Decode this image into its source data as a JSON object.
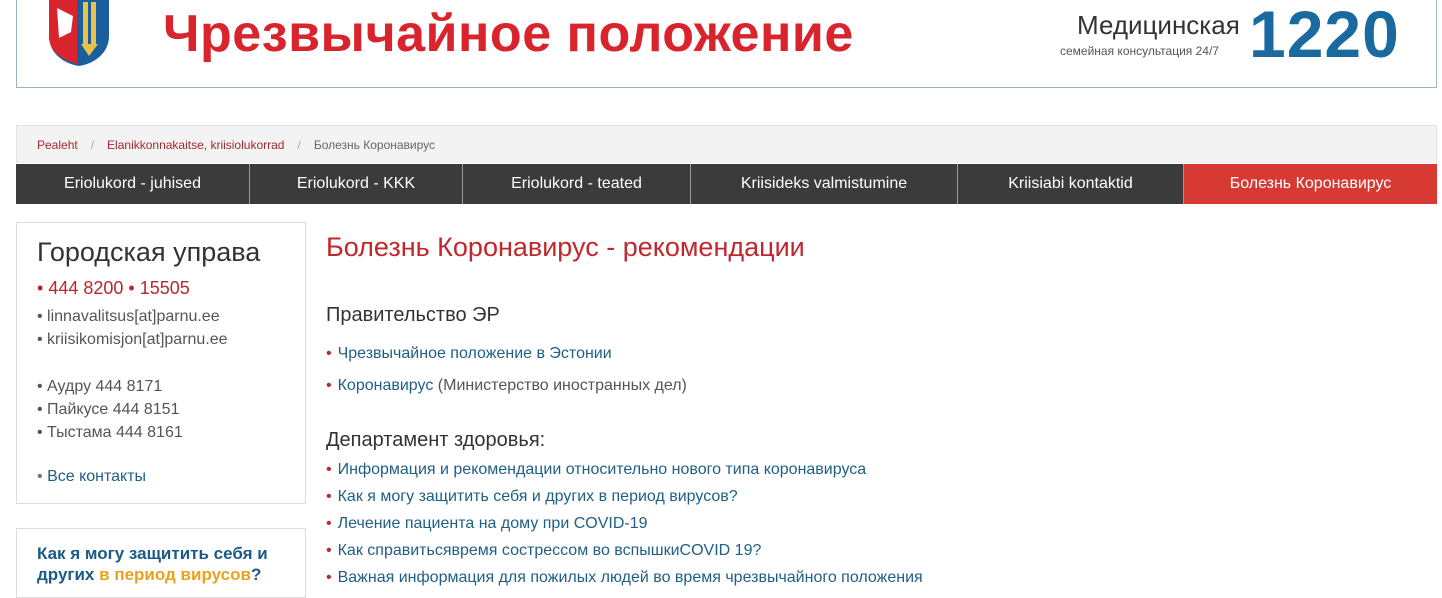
{
  "banner": {
    "title": "Чрезвычайное положение",
    "med_label": "Медицинская",
    "med_sub": "семейная консультация 24/7",
    "med_number": "1220"
  },
  "breadcrumb": {
    "items": [
      "Pealeht",
      "Elanikkonnakaitse, kriisiolukorrad"
    ],
    "current": "Болезнь Коронавирус",
    "separator": "/"
  },
  "nav": {
    "items": [
      "Eriolukord - juhised",
      "Eriolukord - KKK",
      "Eriolukord - teated",
      "Kriisideks valmistumine",
      "Kriisiabi kontaktid",
      "Болезнь Коронавирус"
    ]
  },
  "sidebar": {
    "title": "Городская управа",
    "phone1": "444 8200",
    "phone2": "15505",
    "emails": [
      "linnavalitsus[at]parnu.ee",
      "kriisikomisjon[at]parnu.ee"
    ],
    "contacts": [
      "Аудру 444 8171",
      "Пайкусе 444 8151",
      "Тыстама 444 8161"
    ],
    "all_contacts": "Все контакты",
    "promo_line1": "Как я могу защитить себя и",
    "promo_line2_a": "других",
    "promo_line2_b": "в период вирусов",
    "promo_line2_c": "?"
  },
  "main": {
    "title": "Болезнь Коронавирус - рекомендации",
    "gov_heading": "Правительство ЭР",
    "gov_link1": "Чрезвычайное положение в Эстонии",
    "gov_link2": "Коронавирус",
    "gov_link2_note": "(Министерство иностранных дел)",
    "health_heading": "Департамент здоровья:",
    "health_links": [
      "Информация и рекомендации относительно нового типа коронавируса",
      "Как я могу защитить себя и других в период вирусов?",
      "Лечение пациента на дому при COVID-19",
      "Как справитьсявремя сострессом во вспышкиCOVID 19?",
      "Важная информация для пожилых людей во время чрезвычайного положения"
    ]
  },
  "colors": {
    "accent_red": "#d9242d",
    "link_blue": "#1f5f86",
    "nav_bg": "#3b3b3b",
    "nav_active": "#d63a33"
  }
}
